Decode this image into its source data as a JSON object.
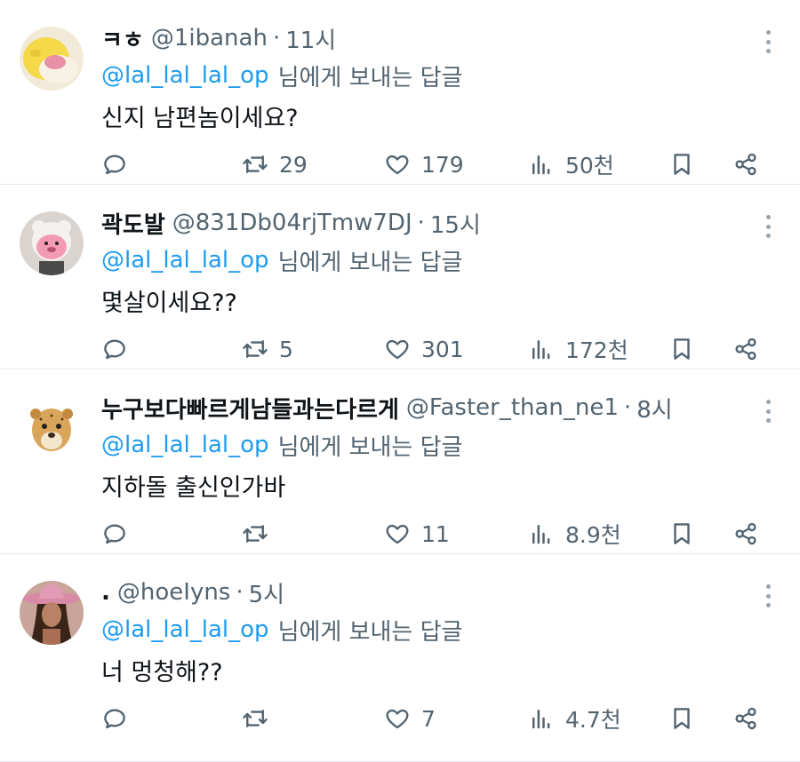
{
  "reply_prefix": "님에게 보내는 답글",
  "colors": {
    "accent": "#1d9bf0",
    "muted": "#536471",
    "text": "#0f1419",
    "divider": "#e6e9ec"
  },
  "tweets": [
    {
      "name": "ㅋㅎ",
      "handle": "@1ibanah",
      "sep": "·",
      "time": "11시",
      "mention": "@lal_lal_lal_op",
      "text": "신지 남편놈이세요?",
      "replies": "",
      "retweets": "29",
      "likes": "179",
      "views": "50천",
      "avatar_icon": "yellow-plush-avatar"
    },
    {
      "name": "곽도발",
      "handle": "@831Db04rjTmw7DJ",
      "sep": "·",
      "time": "15시",
      "mention": "@lal_lal_lal_op",
      "text": "몇살이세요??",
      "replies": "",
      "retweets": "5",
      "likes": "301",
      "views": "172천",
      "avatar_icon": "pink-beaver-avatar"
    },
    {
      "name": "누구보다빠르게남들과는다르게",
      "handle": "@Faster_than_ne1",
      "sep": "·",
      "time": "8시",
      "mention": "@lal_lal_lal_op",
      "text": "지하돌 출신인가바",
      "replies": "",
      "retweets": "",
      "likes": "11",
      "views": "8.9천",
      "avatar_icon": "cheetah-avatar"
    },
    {
      "name": ".",
      "handle": "@hoeIyns",
      "sep": "·",
      "time": "5시",
      "mention": "@lal_lal_lal_op",
      "text": "너 멍청해??",
      "replies": "",
      "retweets": "",
      "likes": "7",
      "views": "4.7천",
      "avatar_icon": "cowboy-hat-person-avatar"
    }
  ]
}
